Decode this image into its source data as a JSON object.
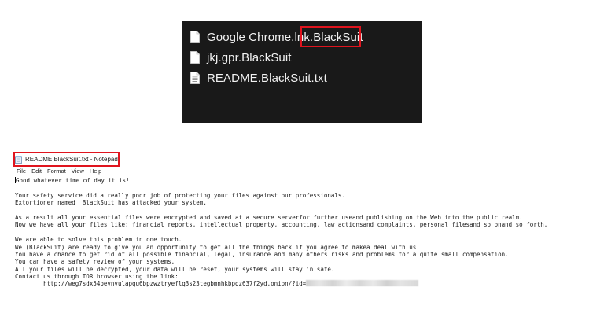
{
  "explorer": {
    "files": [
      {
        "name": "Google Chrome.lnk.BlackSuit",
        "icon": "file-icon"
      },
      {
        "name": "jkj.gpr.BlackSuit",
        "icon": "file-icon"
      },
      {
        "name": "README.BlackSuit.txt",
        "icon": "text-file-icon"
      }
    ],
    "highlight_color": "#e0141e",
    "background": "#191919"
  },
  "notepad": {
    "title": "README.BlackSuit.txt - Notepad",
    "menu": [
      "File",
      "Edit",
      "Format",
      "View",
      "Help"
    ],
    "lines": [
      "Good whatever time of day it is!",
      "",
      "Your safety service did a really poor job of protecting your files against our professionals.",
      "Extortioner named  BlackSuit has attacked your system.",
      "",
      "As a result all your essential files were encrypted and saved at a secure serverfor further useand publishing on the Web into the public realm.",
      "Now we have all your files like: financial reports, intellectual property, accounting, law actionsand complaints, personal filesand so onand so forth.",
      "",
      "We are able to solve this problem in one touch.",
      "We (BlackSuit) are ready to give you an opportunity to get all the things back if you agree to makea deal with us.",
      "You have a chance to get rid of all possible financial, legal, insurance and many others risks and problems for a quite small compensation.",
      "You can have a safety review of your systems.",
      "All your files will be decrypted, your data will be reset, your systems will stay in safe.",
      "Contact us through TOR browser using the link:"
    ],
    "link_prefix": "        http://weg7sdx54bevnvulapqu6bpzwztryeflq3s23tegbmnhkbpqz637f2yd.onion/?id="
  }
}
